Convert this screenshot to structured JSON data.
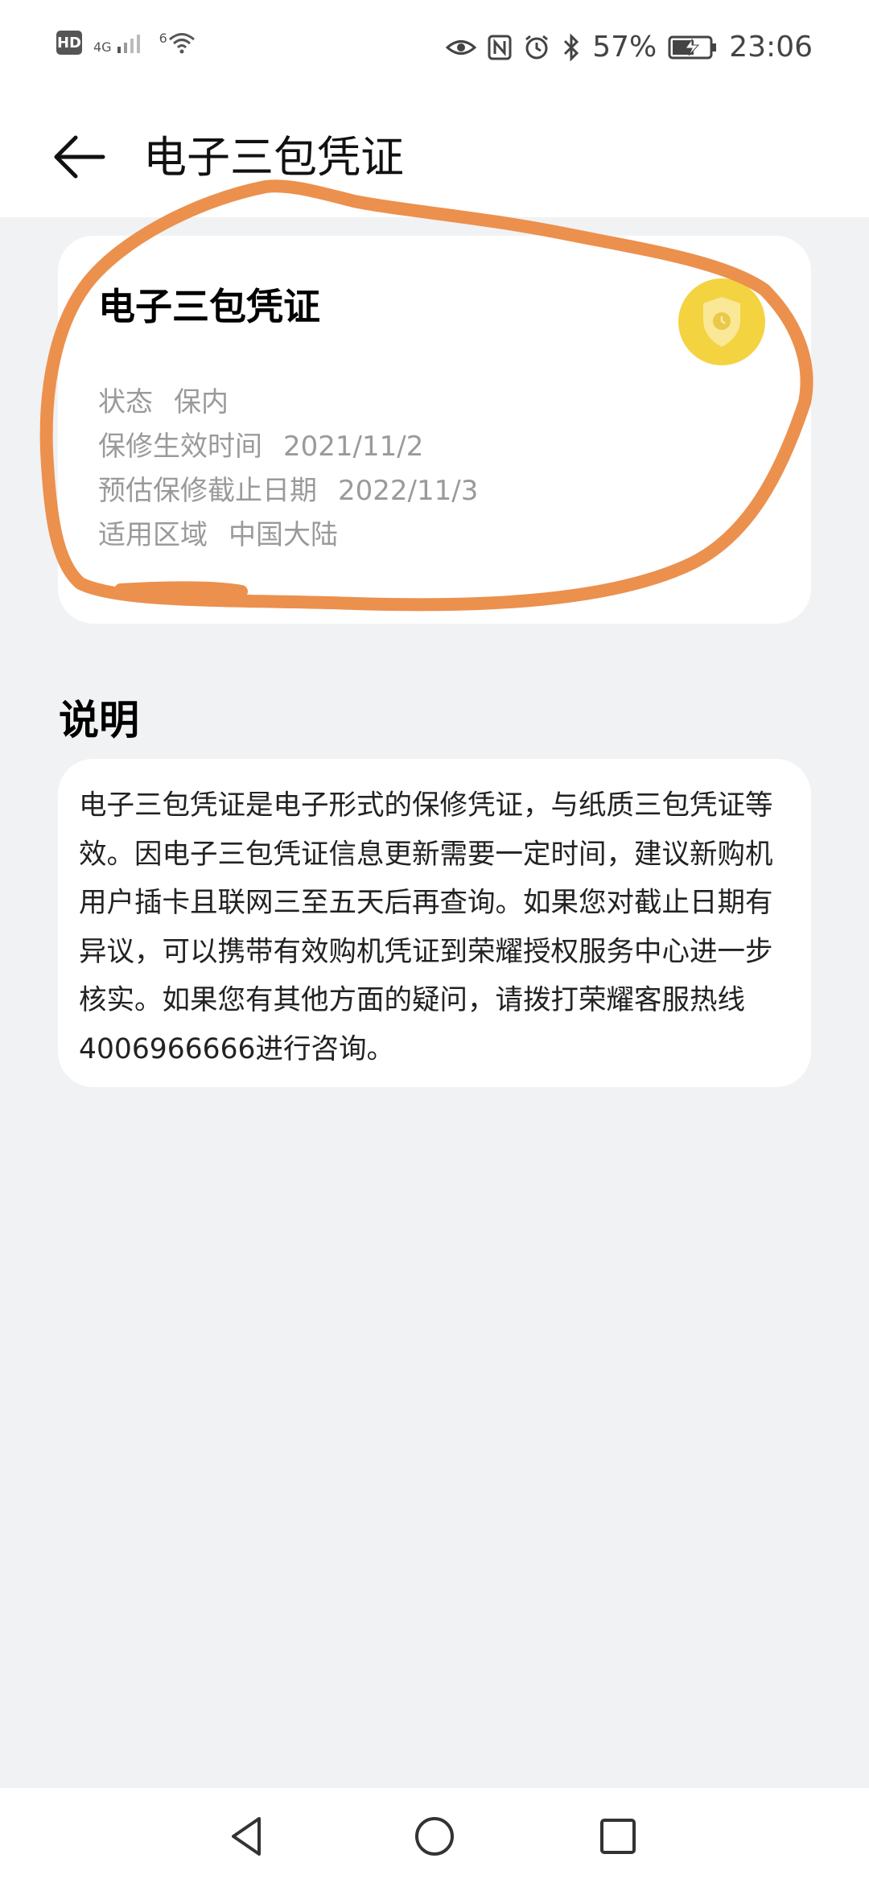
{
  "status_bar": {
    "hd": "HD",
    "network": "4G",
    "wifi": "6",
    "battery": "57%",
    "time": "23:06"
  },
  "header": {
    "title": "电子三包凭证"
  },
  "card": {
    "title": "电子三包凭证",
    "rows": [
      {
        "label": "状态",
        "value": "保内"
      },
      {
        "label": "保修生效时间",
        "value": "2021/11/2"
      },
      {
        "label": "预估保修截止日期",
        "value": "2022/11/3"
      },
      {
        "label": "适用区域",
        "value": "中国大陆"
      }
    ]
  },
  "section": {
    "title": "说明",
    "description": "电子三包凭证是电子形式的保修凭证，与纸质三包凭证等效。因电子三包凭证信息更新需要一定时间，建议新购机用户插卡且联网三至五天后再查询。如果您对截止日期有异议，可以携带有效购机凭证到荣耀授权服务中心进一步核实。如果您有其他方面的疑问，请拨打荣耀客服热线4006966666进行咨询。"
  },
  "colors": {
    "accent_shield": "#f4d341",
    "annotation": "#ec904e",
    "background": "#f1f2f4"
  }
}
